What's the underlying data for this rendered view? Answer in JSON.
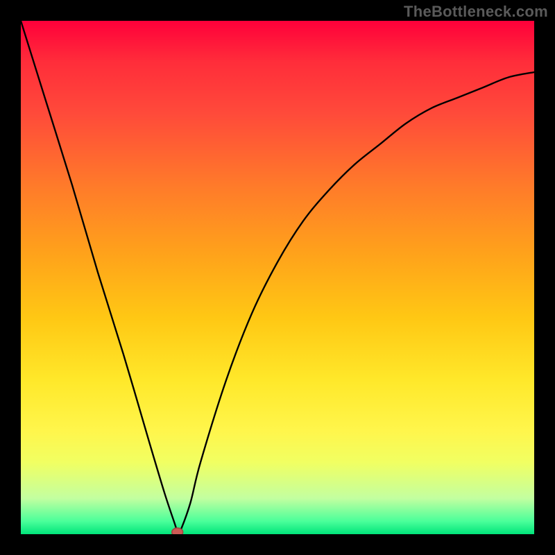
{
  "watermark": "TheBottleneck.com",
  "chart_data": {
    "type": "line",
    "title": "",
    "xlabel": "",
    "ylabel": "",
    "xlim": [
      0,
      1
    ],
    "ylim": [
      0,
      1
    ],
    "series": [
      {
        "name": "bottleneck-curve",
        "x": [
          0.0,
          0.05,
          0.1,
          0.15,
          0.2,
          0.25,
          0.28,
          0.3,
          0.305,
          0.31,
          0.33,
          0.35,
          0.4,
          0.45,
          0.5,
          0.55,
          0.6,
          0.65,
          0.7,
          0.75,
          0.8,
          0.85,
          0.9,
          0.95,
          1.0
        ],
        "values": [
          1.0,
          0.84,
          0.68,
          0.51,
          0.35,
          0.18,
          0.08,
          0.02,
          0.005,
          0.005,
          0.06,
          0.14,
          0.3,
          0.43,
          0.53,
          0.61,
          0.67,
          0.72,
          0.76,
          0.8,
          0.83,
          0.85,
          0.87,
          0.89,
          0.9
        ]
      }
    ],
    "marker": {
      "x": 0.305,
      "y": 0.004
    },
    "colors": {
      "gradient_top": "#ff003a",
      "gradient_mid": "#ffe82a",
      "gradient_bottom": "#00e47a",
      "curve": "#000000",
      "marker": "#cc5a55",
      "frame": "#000000",
      "watermark": "#5a5a5a"
    }
  }
}
